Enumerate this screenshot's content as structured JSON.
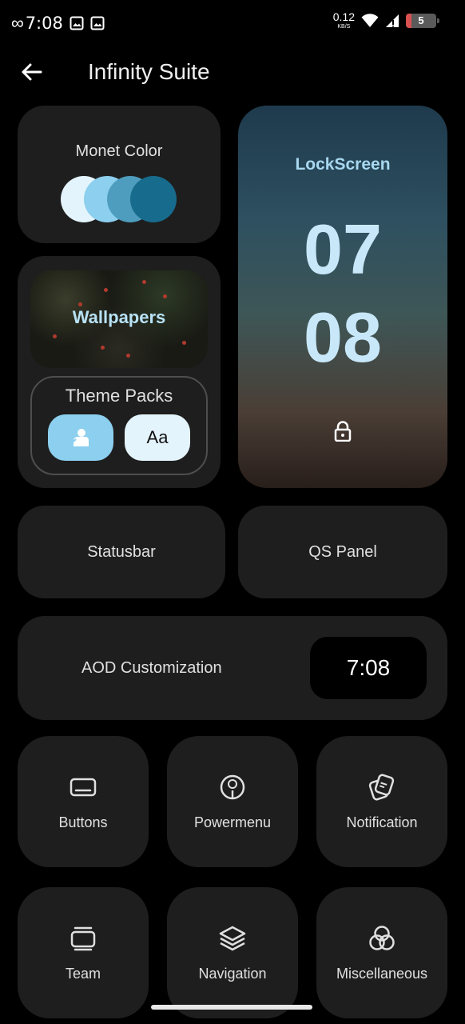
{
  "status_bar": {
    "time": "7:08",
    "net_speed": "0.12",
    "net_unit": "KB/S",
    "battery_level": "5",
    "left_icons": [
      "infinity-icon",
      "image-icon",
      "image-icon"
    ],
    "right_icons": [
      "wifi-icon",
      "signal-icon",
      "battery-icon"
    ]
  },
  "app_bar": {
    "title": "Infinity Suite",
    "back_icon": "arrow-left-icon"
  },
  "monet": {
    "label": "Monet Color",
    "swatches": [
      "#e4f4fc",
      "#8ccfee",
      "#4e9dbe",
      "#176b8c"
    ]
  },
  "lockscreen": {
    "label": "LockScreen",
    "hour": "07",
    "minute": "08",
    "icon": "lock-icon"
  },
  "wallpapers": {
    "label": "Wallpapers"
  },
  "theme_packs": {
    "label": "Theme Packs",
    "font_button": "Aa",
    "icon": "person-icon"
  },
  "statusbar_card": {
    "label": "Statusbar"
  },
  "qs_panel": {
    "label": "QS Panel"
  },
  "aod": {
    "label": "AOD Customization",
    "time": "7:08"
  },
  "tiles": [
    {
      "label": "Buttons",
      "icon": "buttons-icon"
    },
    {
      "label": "Powermenu",
      "icon": "power-menu-icon"
    },
    {
      "label": "Notification",
      "icon": "notification-icon"
    },
    {
      "label": "Team",
      "icon": "team-icon"
    },
    {
      "label": "Navigation",
      "icon": "layers-icon"
    },
    {
      "label": "Miscellaneous",
      "icon": "circles-icon"
    }
  ],
  "colors": {
    "background": "#000000",
    "card": "#1e1e1e",
    "accent": "#a8d8f0"
  }
}
